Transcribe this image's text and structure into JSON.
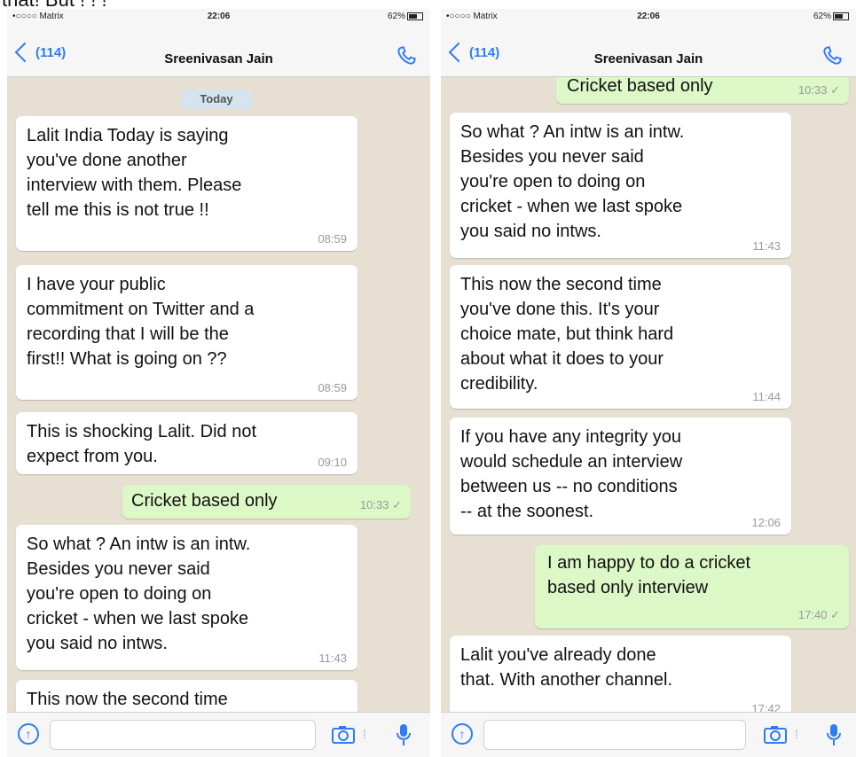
{
  "top_text": "that! But ! ! !",
  "statusbar": {
    "carrier": "•○○○○ Matrix",
    "time": "22:06",
    "battery": "62%"
  },
  "header": {
    "back_label": "(114)",
    "title": "Sreenivasan Jain"
  },
  "left": {
    "date_label": "Today",
    "messages": [
      {
        "text": "Lalit India Today is saying\nyou've done another\ninterview with them. Please\ntell me this is not true !!",
        "time": "08:59"
      },
      {
        "text": "I have your public\ncommitment on Twitter and a\nrecording that I will be the\nfirst!! What is going on ??",
        "time": "08:59"
      },
      {
        "text": "This is shocking Lalit. Did not\nexpect from you.",
        "time": "09:10"
      },
      {
        "text": "Cricket based only",
        "time": "10:33"
      },
      {
        "text": "So what ? An intw is an intw.\nBesides you never said\nyou're open to doing on\ncricket - when we last spoke\nyou said no intws.",
        "time": "11:43"
      },
      {
        "text": "This now the second time",
        "time": ""
      }
    ]
  },
  "right": {
    "messages": [
      {
        "text": "Cricket based only",
        "time": "10:33"
      },
      {
        "text": "So what ? An intw is an intw.\nBesides you never said\nyou're open to doing on\ncricket - when we last spoke\nyou said no intws.",
        "time": "11:43"
      },
      {
        "text": "This now the second time\nyou've done this. It's your\nchoice mate, but think hard\nabout what it does to your\ncredibility.",
        "time": "11:44"
      },
      {
        "text": "If you have any integrity you\nwould schedule an interview\nbetween us -- no conditions\n-- at the soonest.",
        "time": "12:06"
      },
      {
        "text": "I am happy to do a cricket\nbased only interview",
        "time": "17:40"
      },
      {
        "text": "Lalit you've already done\nthat. With another channel.",
        "time": "17:42"
      }
    ]
  },
  "colors": {
    "accent": "#2f7cf6",
    "outgoing_bubble": "#dcf8c6",
    "incoming_bubble": "#ffffff",
    "chat_background": "#e6dfd2"
  },
  "icons": {
    "back": "chevron-left-icon",
    "call": "phone-icon",
    "attach": "upload-icon",
    "camera": "camera-icon",
    "mic": "microphone-icon",
    "read": "double-check-icon"
  }
}
